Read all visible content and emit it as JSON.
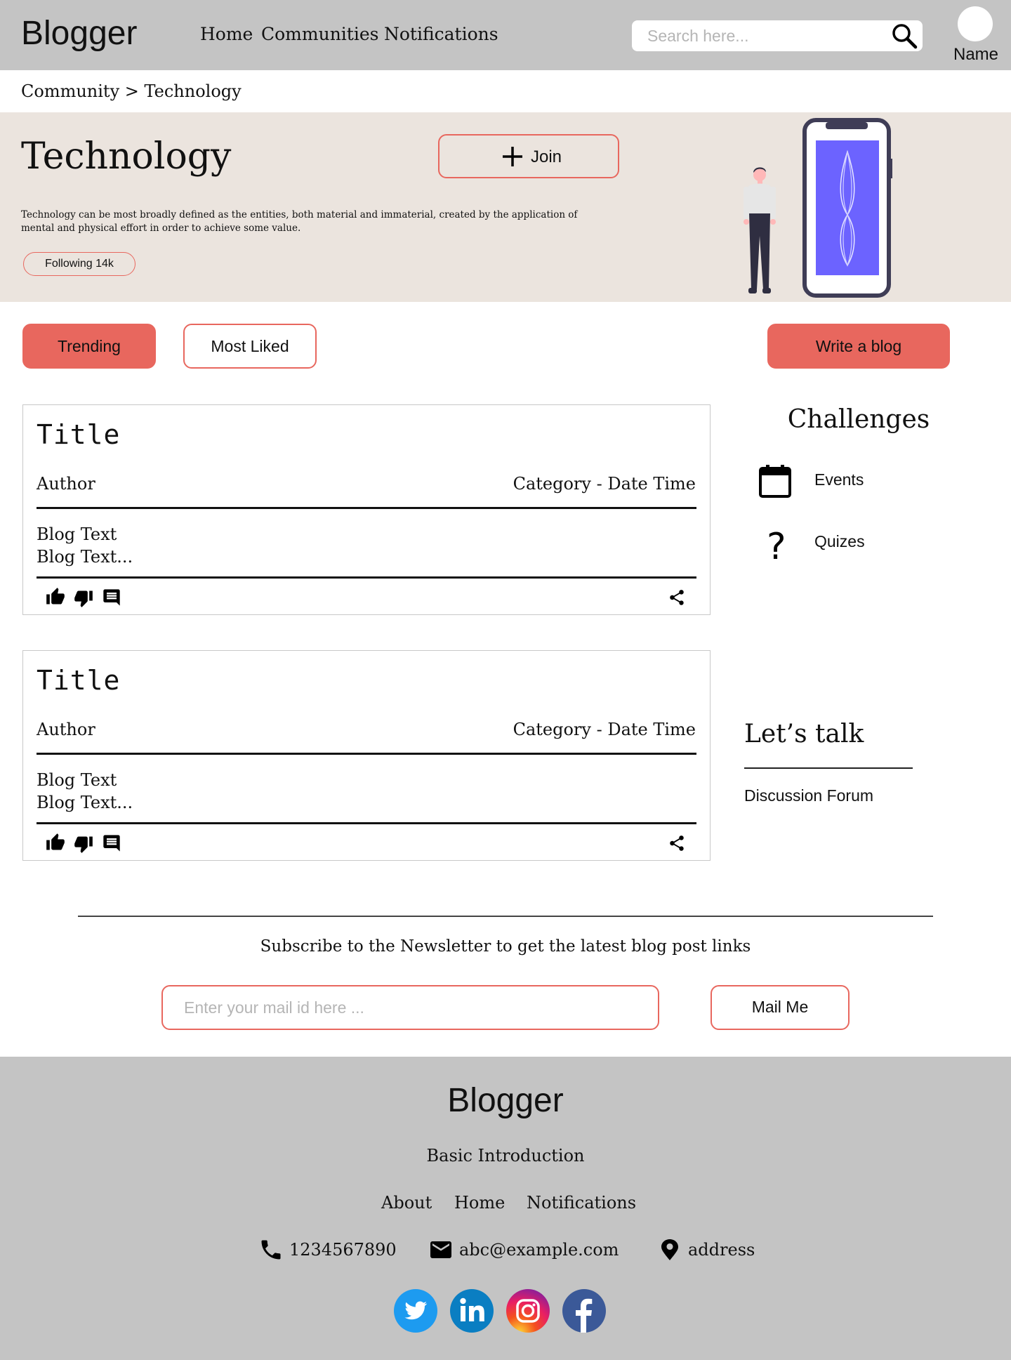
{
  "header": {
    "logo": "Blogger",
    "nav": [
      "Home",
      "Communities",
      "Notifications"
    ],
    "search_placeholder": "Search here...",
    "user_name": "Name"
  },
  "breadcrumb": "Community > Technology",
  "community": {
    "title": "Technology",
    "join_label": "Join",
    "description": "Technology can be most broadly defined as the entities, both material and immaterial, created by the application of mental and physical effort in order to achieve some value.",
    "following": "Following 14k"
  },
  "tabs": {
    "trending": "Trending",
    "most_liked": "Most Liked",
    "write_blog": "Write a blog"
  },
  "posts": [
    {
      "title": "Title",
      "author": "Author",
      "meta": "Category - Date Time",
      "line1": "Blog Text",
      "line2": "Blog Text..."
    },
    {
      "title": "Title",
      "author": "Author",
      "meta": "Category - Date Time",
      "line1": "Blog Text",
      "line2": "Blog Text..."
    }
  ],
  "sidebar": {
    "challenges_heading": "Challenges",
    "challenges": [
      {
        "label": "Events",
        "icon": "calendar-icon"
      },
      {
        "label": "Quizes",
        "icon": "question-icon"
      }
    ],
    "lets_talk_heading": "Let’s talk",
    "discussion_forum": "Discussion Forum"
  },
  "newsletter": {
    "text": "Subscribe to the Newsletter to get the latest blog post links",
    "email_placeholder": "Enter your mail id here ...",
    "button": "Mail Me"
  },
  "footer": {
    "logo": "Blogger",
    "intro": "Basic Introduction",
    "links": [
      "About",
      "Home",
      "Notifications"
    ],
    "phone": "1234567890",
    "email": "abc@example.com",
    "address": "address",
    "social": [
      "twitter-icon",
      "linkedin-icon",
      "instagram-icon",
      "facebook-icon"
    ]
  },
  "colors": {
    "accent": "#e8675e",
    "header_bg": "#c4c4c4",
    "banner_bg": "#ebe4de",
    "phone_screen": "#6c63ff"
  }
}
